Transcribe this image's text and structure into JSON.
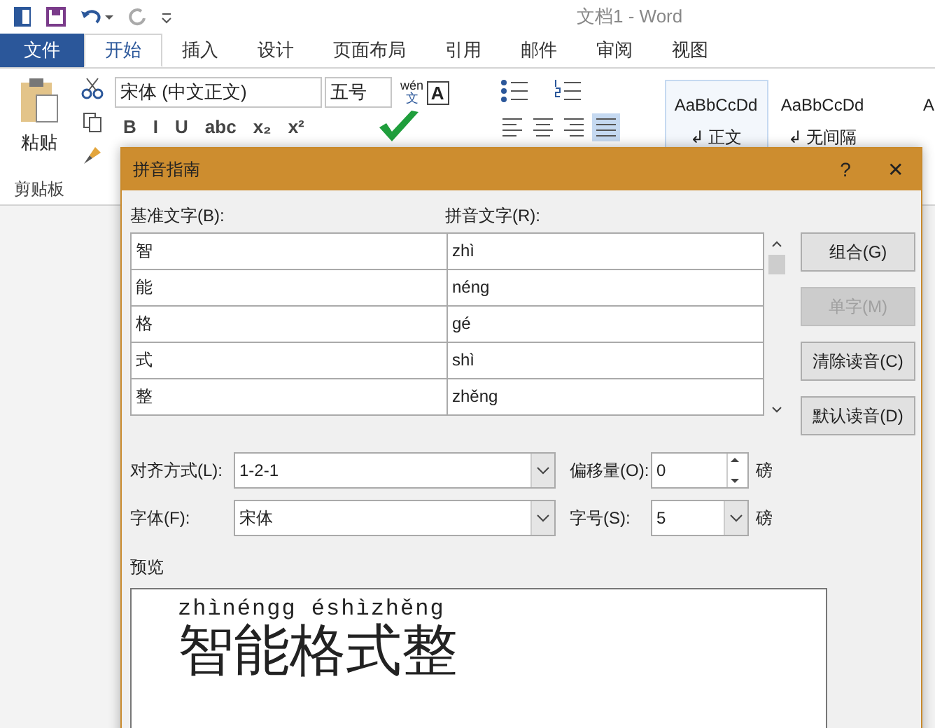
{
  "window": {
    "title": "文档1 - Word"
  },
  "ribbon_tabs": [
    {
      "label": "文件",
      "kind": "file",
      "selected": false
    },
    {
      "label": "开始",
      "kind": "tab",
      "selected": true
    },
    {
      "label": "插入",
      "kind": "tab",
      "selected": false
    },
    {
      "label": "设计",
      "kind": "tab",
      "selected": false
    },
    {
      "label": "页面布局",
      "kind": "tab",
      "selected": false
    },
    {
      "label": "引用",
      "kind": "tab",
      "selected": false
    },
    {
      "label": "邮件",
      "kind": "tab",
      "selected": false
    },
    {
      "label": "审阅",
      "kind": "tab",
      "selected": false
    },
    {
      "label": "视图",
      "kind": "tab",
      "selected": false
    }
  ],
  "clipboard": {
    "paste_label": "粘贴",
    "group_label": "剪贴板"
  },
  "font": {
    "name": "宋体 (中文正文)",
    "size": "五号",
    "phonetic_top": "wén",
    "phonetic_bottom": "文",
    "border_char": "A",
    "formats": [
      "B",
      "I",
      "U",
      "abc",
      "x₂",
      "x²"
    ]
  },
  "styles": [
    {
      "sample": "AaBbCcDd",
      "name": "↲ 正文",
      "selected": true
    },
    {
      "sample": "AaBbCcDd",
      "name": "↲ 无间隔",
      "selected": false
    },
    {
      "sample": "A",
      "selected": false
    }
  ],
  "dialog": {
    "title": "拼音指南",
    "help": "?",
    "close": "✕",
    "base_label": "基准文字(B):",
    "ruby_label": "拼音文字(R):",
    "rows": [
      {
        "base": "智",
        "ruby": "zhì"
      },
      {
        "base": "能",
        "ruby": "néng"
      },
      {
        "base": "格",
        "ruby": "gé"
      },
      {
        "base": "式",
        "ruby": "shì"
      },
      {
        "base": "整",
        "ruby": "zhěng"
      }
    ],
    "buttons": [
      {
        "label": "组合(G)",
        "disabled": false
      },
      {
        "label": "单字(M)",
        "disabled": true
      },
      {
        "label": "清除读音(C)",
        "disabled": false
      },
      {
        "label": "默认读音(D)",
        "disabled": false
      }
    ],
    "alignment": {
      "label": "对齐方式(L):",
      "value": "1-2-1"
    },
    "offset": {
      "label": "偏移量(O):",
      "value": "0",
      "unit": "磅"
    },
    "font": {
      "label": "字体(F):",
      "value": "宋体"
    },
    "size": {
      "label": "字号(S):",
      "value": "5",
      "unit": "磅"
    },
    "preview": {
      "label": "预览",
      "ruby": "zhìnéngg éshìzhěng",
      "base": "智能格式整"
    }
  }
}
